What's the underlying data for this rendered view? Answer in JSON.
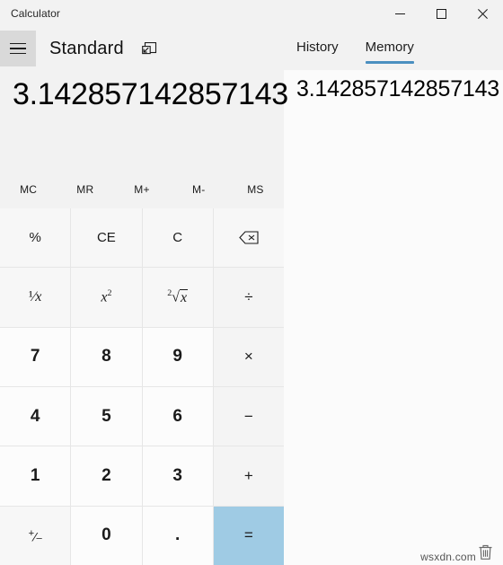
{
  "window": {
    "title": "Calculator",
    "controls": [
      {
        "name": "minimize",
        "glyph": "minimize-icon"
      },
      {
        "name": "maximize",
        "glyph": "maximize-icon"
      },
      {
        "name": "close",
        "glyph": "close-icon"
      }
    ]
  },
  "header": {
    "menu_icon": "hamburger-icon",
    "mode_label": "Standard",
    "keep_on_top_icon": "keep-on-top-icon"
  },
  "panel": {
    "tabs": [
      {
        "label": "History",
        "active": false
      },
      {
        "label": "Memory",
        "active": true
      }
    ],
    "memory_items": [
      {
        "value": "3.142857142857143"
      }
    ],
    "clear_icon": "trash-icon"
  },
  "display": {
    "value": "3.142857142857143"
  },
  "memory_buttons": [
    {
      "label": "MC",
      "name": "memory-clear"
    },
    {
      "label": "MR",
      "name": "memory-recall"
    },
    {
      "label": "M+",
      "name": "memory-add"
    },
    {
      "label": "M-",
      "name": "memory-subtract"
    },
    {
      "label": "MS",
      "name": "memory-store"
    }
  ],
  "keypad": {
    "rows": [
      [
        {
          "label": "%",
          "name": "percent",
          "kind": "func"
        },
        {
          "label": "CE",
          "name": "clear-entry",
          "kind": "func"
        },
        {
          "label": "C",
          "name": "clear",
          "kind": "func"
        },
        {
          "label": "",
          "name": "backspace",
          "kind": "func",
          "icon": "backspace-icon"
        }
      ],
      [
        {
          "label": "",
          "name": "reciprocal",
          "kind": "func",
          "icon": "one-over-x-icon"
        },
        {
          "label": "",
          "name": "square",
          "kind": "func",
          "icon": "x-squared-icon"
        },
        {
          "label": "",
          "name": "square-root",
          "kind": "func",
          "icon": "square-root-icon"
        },
        {
          "label": "÷",
          "name": "divide",
          "kind": "op"
        }
      ],
      [
        {
          "label": "7",
          "name": "seven",
          "kind": "num"
        },
        {
          "label": "8",
          "name": "eight",
          "kind": "num"
        },
        {
          "label": "9",
          "name": "nine",
          "kind": "num"
        },
        {
          "label": "×",
          "name": "multiply",
          "kind": "op"
        }
      ],
      [
        {
          "label": "4",
          "name": "four",
          "kind": "num"
        },
        {
          "label": "5",
          "name": "five",
          "kind": "num"
        },
        {
          "label": "6",
          "name": "six",
          "kind": "num"
        },
        {
          "label": "−",
          "name": "subtract",
          "kind": "op"
        }
      ],
      [
        {
          "label": "1",
          "name": "one",
          "kind": "num"
        },
        {
          "label": "2",
          "name": "two",
          "kind": "num"
        },
        {
          "label": "3",
          "name": "three",
          "kind": "num"
        },
        {
          "label": "+",
          "name": "add",
          "kind": "op"
        }
      ],
      [
        {
          "label": "",
          "name": "negate",
          "kind": "func",
          "icon": "plus-minus-icon"
        },
        {
          "label": "0",
          "name": "zero",
          "kind": "num"
        },
        {
          "label": ".",
          "name": "decimal",
          "kind": "num"
        },
        {
          "label": "=",
          "name": "equals",
          "kind": "equals"
        }
      ]
    ]
  },
  "watermark": {
    "text": "wsxdn.com"
  },
  "colors": {
    "accent": "#4a8fc0",
    "equals_bg": "#9fcbe4",
    "window_bg": "#f2f2f2",
    "key_bg": "#fbfbfb"
  }
}
